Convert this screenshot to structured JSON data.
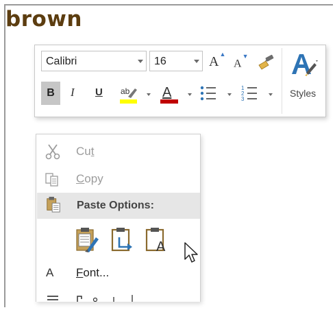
{
  "document": {
    "heading_word": "brown"
  },
  "mini_toolbar": {
    "font_name": "Calibri",
    "font_size": "16",
    "grow_font_glyph": "A",
    "shrink_font_glyph": "A",
    "bold_label": "B",
    "italic_label": "I",
    "underline_label": "U",
    "highlight_letters": "ab",
    "font_color_letter": "A",
    "styles_label": "Styles",
    "colors": {
      "highlight": "#ffff00",
      "font_color": "#c00000",
      "accent": "#2e74b5"
    }
  },
  "context_menu": {
    "items": [
      {
        "label_pre": "Cu",
        "label_ul": "t",
        "label_post": "",
        "icon": "scissors-icon",
        "enabled": false
      },
      {
        "label_pre": "",
        "label_ul": "C",
        "label_post": "opy",
        "icon": "copy-icon",
        "enabled": false
      },
      {
        "label_pre": "Paste Options:",
        "icon": "paste-icon",
        "enabled": true
      },
      {
        "label_pre": "",
        "label_ul": "F",
        "label_post": "ont...",
        "icon": "font-icon",
        "enabled": true
      }
    ],
    "paste_options": [
      "keep-source-formatting-icon",
      "merge-formatting-icon",
      "keep-text-only-icon"
    ],
    "keep_text_letter": "A",
    "font_icon_letter": "A"
  }
}
